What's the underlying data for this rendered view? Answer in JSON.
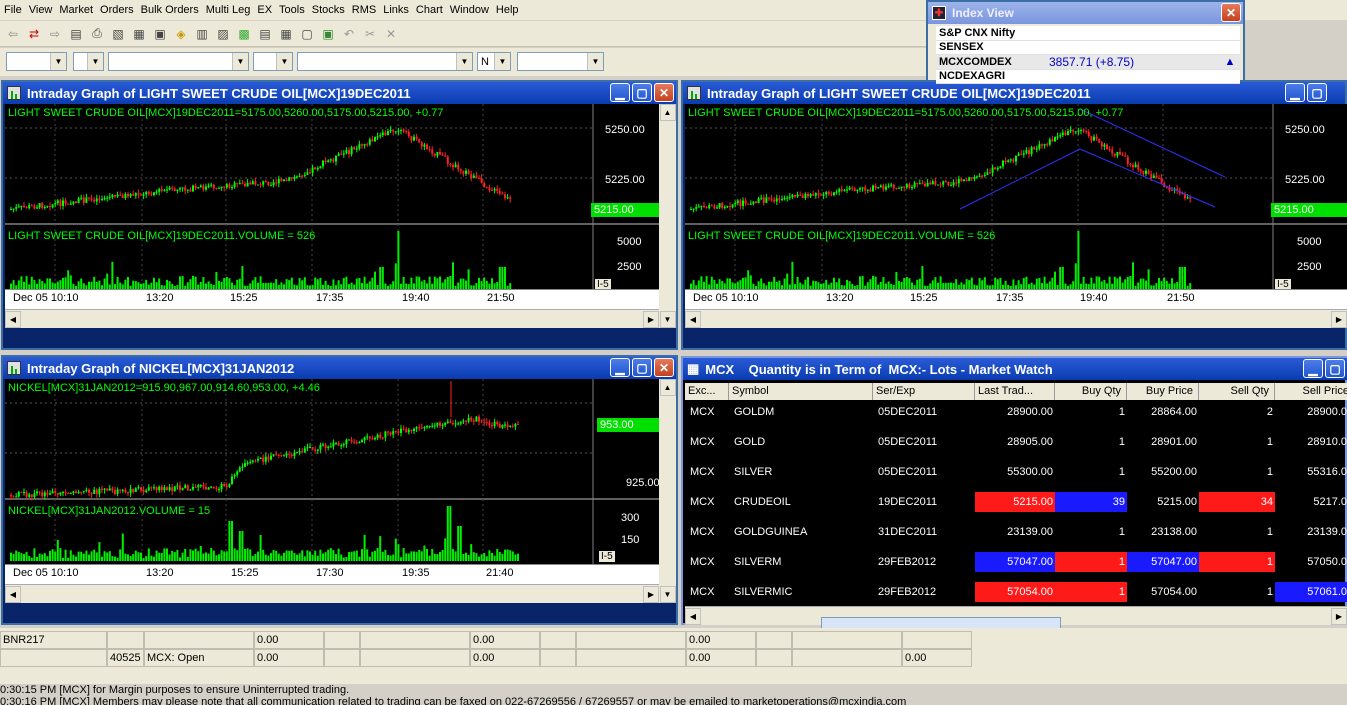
{
  "menu": [
    "File",
    "View",
    "Market",
    "Orders",
    "Bulk Orders",
    "Multi Leg",
    "EX",
    "Tools",
    "Stocks",
    "RMS",
    "Links",
    "Chart",
    "Window",
    "Help"
  ],
  "toolbar_dropdowns": [
    {
      "value": ""
    },
    {
      "value": ""
    },
    {
      "value": ""
    },
    {
      "value": ""
    },
    {
      "value": ""
    },
    {
      "value": "N"
    },
    {
      "value": ""
    }
  ],
  "index_view": {
    "title": "Index View",
    "rows": [
      {
        "name": "S&P CNX Nifty",
        "value": ""
      },
      {
        "name": "SENSEX",
        "value": ""
      },
      {
        "name": "MCXCOMDEX",
        "value": "3857.71 (+8.75)"
      },
      {
        "name": "NCDEXAGRI",
        "value": ""
      }
    ]
  },
  "chart1": {
    "title": "Intraday Graph of LIGHT SWEET CRUDE OIL[MCX]19DEC2011",
    "price_label": "LIGHT SWEET CRUDE OIL[MCX]19DEC2011=5175.00,5260.00,5175.00,5215.00, +0.77",
    "volume_label": "LIGHT SWEET CRUDE OIL[MCX]19DEC2011.VOLUME = 526",
    "price_ticks": [
      "5250.00",
      "5225.00"
    ],
    "last_price": "5215.00",
    "vol_ticks": [
      "5000",
      "2500"
    ],
    "interval": "I-5",
    "x_ticks": [
      "Dec 05 10:10",
      "13:20",
      "15:25",
      "17:35",
      "19:40",
      "21:50"
    ]
  },
  "chart2": {
    "title": "Intraday Graph of LIGHT SWEET CRUDE OIL[MCX]19DEC2011",
    "price_label": "LIGHT SWEET CRUDE OIL[MCX]19DEC2011=5175.00,5260.00,5175.00,5215.00, +0.77",
    "volume_label": "LIGHT SWEET CRUDE OIL[MCX]19DEC2011.VOLUME = 526",
    "price_ticks": [
      "5250.00",
      "5225.00"
    ],
    "last_price": "5215.00",
    "vol_ticks": [
      "5000",
      "2500"
    ],
    "interval": "I-5",
    "x_ticks": [
      "Dec 05 10:10",
      "13:20",
      "15:25",
      "17:35",
      "19:40",
      "21:50"
    ]
  },
  "chart3": {
    "title": "Intraday Graph of NICKEL[MCX]31JAN2012",
    "price_label": "NICKEL[MCX]31JAN2012=915.90,967.00,914.60,953.00, +4.46",
    "volume_label": "NICKEL[MCX]31JAN2012.VOLUME = 15",
    "price_ticks": [
      "925.00"
    ],
    "last_price": "953.00",
    "vol_ticks": [
      "300",
      "150"
    ],
    "interval": "I-5",
    "x_ticks": [
      "Dec 05 10:10",
      "13:20",
      "15:25",
      "17:30",
      "19:35",
      "21:40"
    ]
  },
  "market_watch": {
    "title": "MCX    Quantity is in Term of  MCX:- Lots - Market Watch",
    "columns": [
      "Exc...",
      "Symbol",
      "Ser/Exp",
      "Last Trad...",
      "Buy Qty",
      "Buy Price",
      "Sell Qty",
      "Sell Price"
    ],
    "rows": [
      {
        "exc": "MCX",
        "symbol": "GOLDM",
        "exp": "05DEC2011",
        "ltp": "28900.00",
        "bqty": "1",
        "bprice": "28864.00",
        "sqty": "2",
        "sprice": "28900.0"
      },
      {
        "exc": "MCX",
        "symbol": "GOLD",
        "exp": "05DEC2011",
        "ltp": "28905.00",
        "bqty": "1",
        "bprice": "28901.00",
        "sqty": "1",
        "sprice": "28910.0"
      },
      {
        "exc": "MCX",
        "symbol": "SILVER",
        "exp": "05DEC2011",
        "ltp": "55300.00",
        "bqty": "1",
        "bprice": "55200.00",
        "sqty": "1",
        "sprice": "55316.0"
      },
      {
        "exc": "MCX",
        "symbol": "CRUDEOIL",
        "exp": "19DEC2011",
        "ltp": "5215.00",
        "bqty": "39",
        "bprice": "5215.00",
        "sqty": "34",
        "sprice": "5217.0"
      },
      {
        "exc": "MCX",
        "symbol": "GOLDGUINEA",
        "exp": "31DEC2011",
        "ltp": "23139.00",
        "bqty": "1",
        "bprice": "23138.00",
        "sqty": "1",
        "sprice": "23139.0"
      },
      {
        "exc": "MCX",
        "symbol": "SILVERM",
        "exp": "29FEB2012",
        "ltp": "57047.00",
        "bqty": "1",
        "bprice": "57047.00",
        "sqty": "1",
        "sprice": "57050.0"
      },
      {
        "exc": "MCX",
        "symbol": "SILVERMIC",
        "exp": "29FEB2012",
        "ltp": "57054.00",
        "bqty": "1",
        "bprice": "57054.00",
        "sqty": "1",
        "sprice": "57061.0"
      }
    ]
  },
  "bottom": {
    "row1": [
      "BNR217",
      "0.00",
      "0.00",
      "0.00"
    ],
    "row2": [
      "40525",
      "MCX: Open",
      "0.00",
      "0.00",
      "0.00",
      "0.00"
    ]
  },
  "messages": [
    "0:30:15 PM [MCX] for Margin purposes to ensure Uninterrupted trading.",
    "0:30:16 PM [MCX] Members may please note that all communication related to trading can be faxed on 022-67269556 / 67269557 or may be emailed to marketoperations@mcxindia.com"
  ],
  "colors": {
    "up": "#00ff00",
    "down": "#ff2020",
    "accent": "#0a3cb0",
    "volume": "#00ff00"
  }
}
